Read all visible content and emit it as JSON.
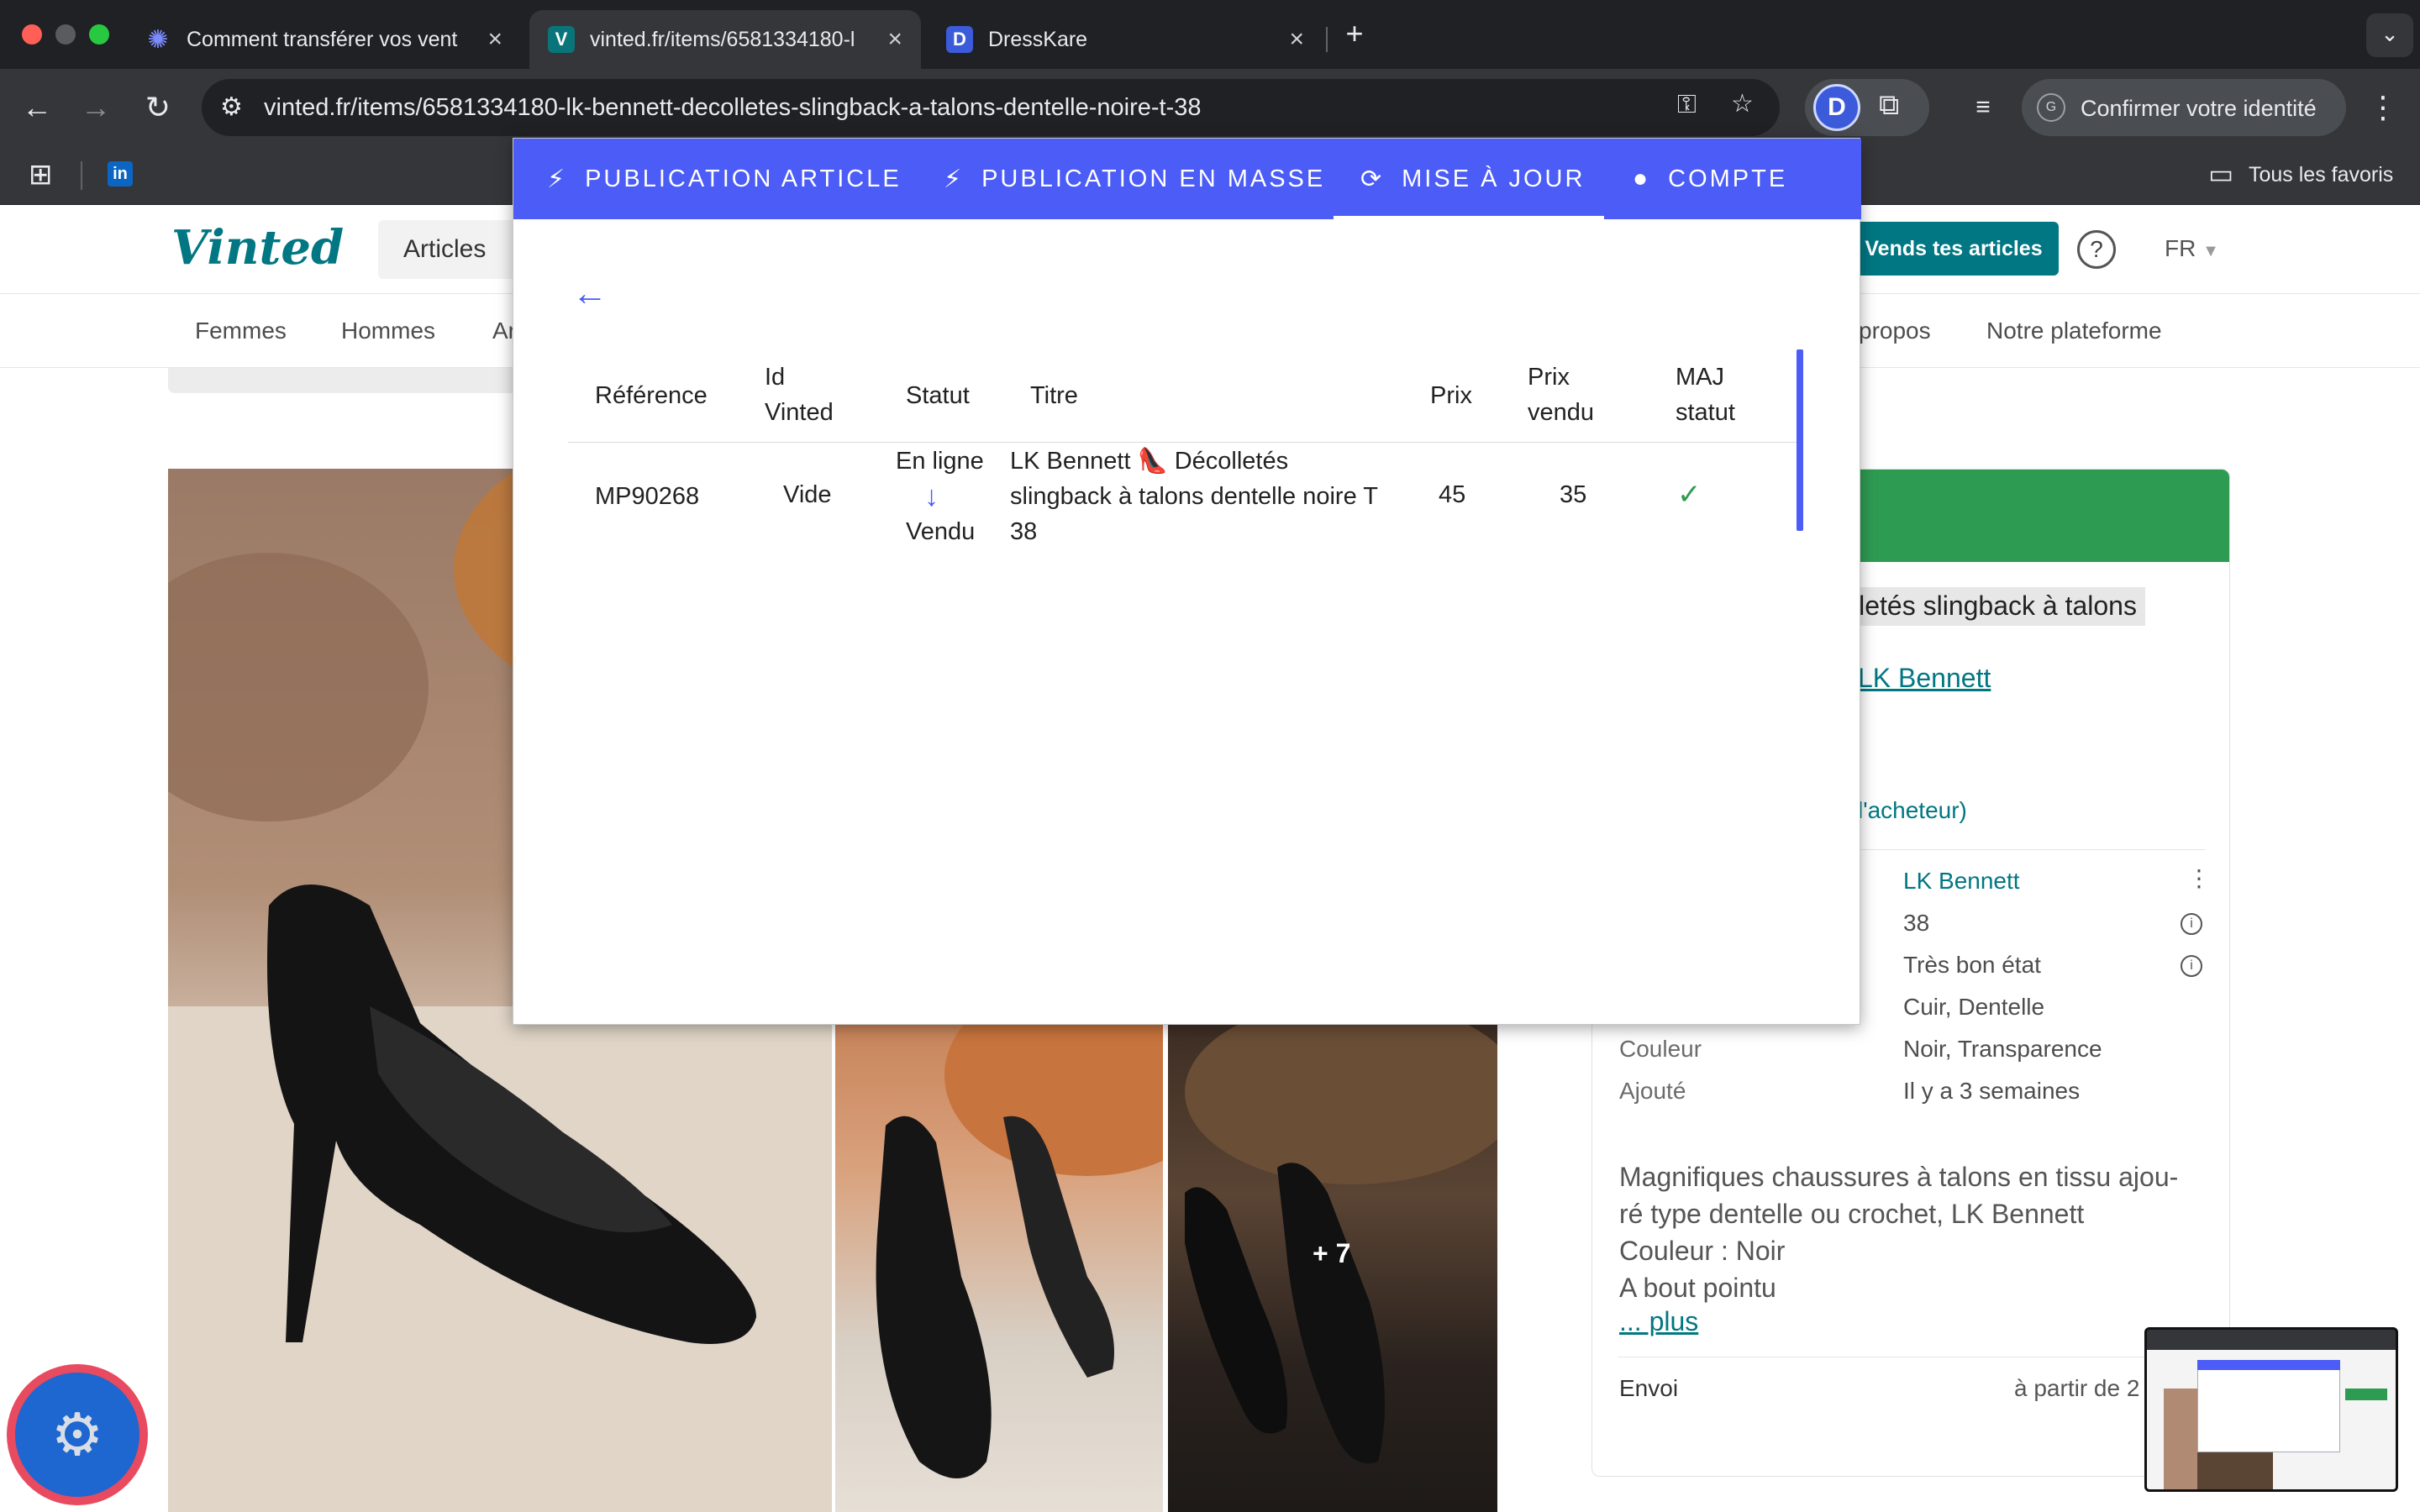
{
  "browser": {
    "tabs": [
      {
        "title": "Comment transférer vos vent",
        "favicon": "gear-badge-icon"
      },
      {
        "title": "vinted.fr/items/6581334180-l",
        "favicon": "V"
      },
      {
        "title": "DressKare",
        "favicon": "D"
      }
    ],
    "url": "vinted.fr/items/6581334180-lk-bennett-decolletes-slingback-a-talons-dentelle-noire-t-38",
    "identity_button": "Confirmer votre identité",
    "bookmarks_label": "Tous les favoris",
    "colors": {
      "tab_bar": "#202124",
      "toolbar": "#35363a"
    }
  },
  "vinted": {
    "logo": "Vinted",
    "search_category": "Articles",
    "sell_button": "Vends tes articles",
    "language": "FR",
    "nav": [
      "Femmes",
      "Hommes",
      "Ar",
      "propos",
      "Notre plateforme"
    ],
    "photo_more": "+ 7",
    "item_title_partial": "lletés slingback à talons",
    "brand_link": "LK Bennett",
    "buyer_note": "l'acheteur)",
    "attributes": [
      {
        "label": "",
        "value": "LK Bennett"
      },
      {
        "label": "",
        "value": "38"
      },
      {
        "label": "",
        "value": "Très bon état"
      },
      {
        "label": "",
        "value": "Cuir, Dentelle"
      },
      {
        "label": "Couleur",
        "value": "Noir, Transparence"
      },
      {
        "label": "Ajouté",
        "value": "Il y a 3 semaines"
      }
    ],
    "description": [
      "Magnifiques chaussures à talons en tissu ajou-",
      "ré type dentelle ou crochet, LK Bennett",
      "Couleur : Noir",
      "A bout pointu"
    ],
    "more_link": "... plus",
    "shipping_label": "Envoi",
    "shipping_value": "à partir de 2",
    "colors": {
      "brand": "#007782",
      "green_banner": "#2e9b52"
    }
  },
  "extension": {
    "tabs": [
      {
        "icon": "bolt-icon",
        "label": "PUBLICATION ARTICLE"
      },
      {
        "icon": "bolt-icon",
        "label": "PUBLICATION EN MASSE"
      },
      {
        "icon": "update-icon",
        "label": "MISE À JOUR",
        "active": true
      },
      {
        "icon": "person-icon",
        "label": "COMPTE"
      }
    ],
    "columns": [
      "Référence",
      "Id Vinted",
      "Statut",
      "Titre",
      "Prix",
      "Prix vendu",
      "MAJ statut"
    ],
    "rows": [
      {
        "reference": "MP90268",
        "id_vinted": "Vide",
        "status_from": "En ligne",
        "status_to": "Vendu",
        "title": "LK Bennett 👠 Décolletés slingback à talons dentelle noire T 38",
        "prix": "45",
        "prix_vendu": "35",
        "maj_statut": "✓"
      }
    ],
    "colors": {
      "accent": "#4b5cf7",
      "check": "#2e9b52"
    }
  }
}
